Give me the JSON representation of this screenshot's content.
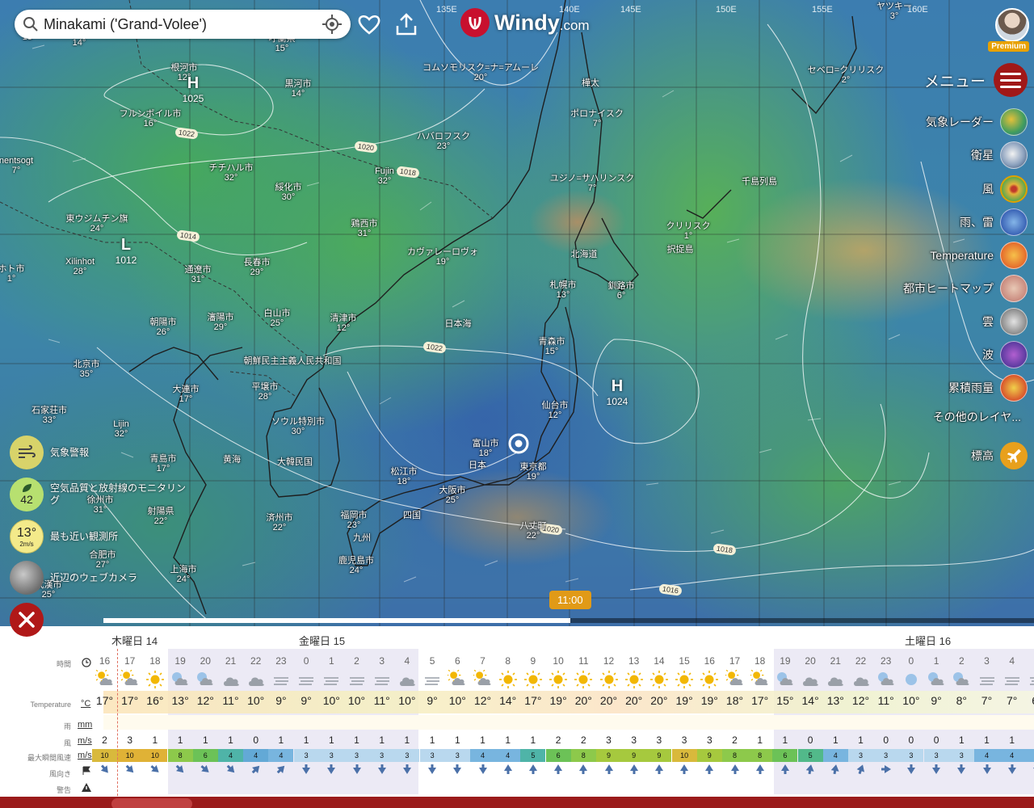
{
  "search": {
    "value": "Minakami ('Grand-Volee')"
  },
  "brand": {
    "name": "Windy",
    "suffix": ".com"
  },
  "account": {
    "badge": "Premium"
  },
  "menu": {
    "label": "メニュー"
  },
  "layers": [
    {
      "label": "気象レーダー",
      "icon": "radar-layer-icon"
    },
    {
      "label": "衛星",
      "icon": "satellite-layer-icon"
    },
    {
      "label": "風",
      "icon": "wind-layer-icon"
    },
    {
      "label": "雨、雷",
      "icon": "rain-layer-icon"
    },
    {
      "label": "Temperature",
      "icon": "temperature-layer-icon"
    },
    {
      "label": "都市ヒートマップ",
      "icon": "heatmap-layer-icon"
    },
    {
      "label": "雲",
      "icon": "clouds-layer-icon"
    },
    {
      "label": "波",
      "icon": "waves-layer-icon"
    },
    {
      "label": "累積雨量",
      "icon": "accumulated-rain-layer-icon"
    },
    {
      "label": "その他のレイヤ...",
      "icon": ""
    }
  ],
  "altitude": {
    "label": "標高"
  },
  "left_widgets": {
    "warnings": {
      "label": "気象警報"
    },
    "air_quality": {
      "value": "42",
      "label": "空気品質と放射線のモニタリング"
    },
    "station": {
      "temp": "13°",
      "wind": "2m/s",
      "label": "最も近い観測所"
    },
    "webcams": {
      "label": "近辺のウェブカメラ"
    }
  },
  "timeline": {
    "current_time": "11:00"
  },
  "longitudes": [
    "135E",
    "140E",
    "145E",
    "150E",
    "155E",
    "160E"
  ],
  "map_labels": [
    {
      "name": "",
      "temp": "13°"
    },
    {
      "name": "",
      "temp": "14°"
    },
    {
      "name": "呼蘭県",
      "temp": "15°"
    },
    {
      "name": "根河市",
      "temp": "12°"
    },
    {
      "name": "黒河市",
      "temp": "14°"
    },
    {
      "name": "フルンボイル市",
      "temp": "16°"
    },
    {
      "name": "チチハル市",
      "temp": "32°"
    },
    {
      "name": "ハバロフスク",
      "temp": "23°"
    },
    {
      "name": "コムソモリスク=ナ=アムーレ",
      "temp": "20°"
    },
    {
      "name": "Fujin",
      "temp": "32°"
    },
    {
      "name": "綏化市",
      "temp": "30°"
    },
    {
      "name": "樺太",
      "temp": ""
    },
    {
      "name": "ポロナイスク",
      "temp": "7°"
    },
    {
      "name": "ユジノ=サハリンスク",
      "temp": "7°"
    },
    {
      "name": "セベロ=クリリスク",
      "temp": "2°"
    },
    {
      "name": "ヤツキー",
      "temp": "3°"
    },
    {
      "name": "千島列島",
      "temp": ""
    },
    {
      "name": "東ウジムチン旗",
      "temp": "24°"
    },
    {
      "name": "鶏西市",
      "temp": "31°"
    },
    {
      "name": "クリリスク",
      "temp": "1°"
    },
    {
      "name": "択捉島",
      "temp": ""
    },
    {
      "name": "Xilinhot",
      "temp": "28°"
    },
    {
      "name": "長春市",
      "temp": "29°"
    },
    {
      "name": "カヴァレーロヴォ",
      "temp": "19°"
    },
    {
      "name": "通遼市",
      "temp": "31°"
    },
    {
      "name": "北海道",
      "temp": ""
    },
    {
      "name": "札幌市",
      "temp": "13°"
    },
    {
      "name": "釧路市",
      "temp": "6°"
    },
    {
      "name": "白山市",
      "temp": "25°"
    },
    {
      "name": "清津市",
      "temp": "12°"
    },
    {
      "name": "瀋陽市",
      "temp": "29°"
    },
    {
      "name": "朝陽市",
      "temp": "26°"
    },
    {
      "name": "日本海",
      "temp": ""
    },
    {
      "name": "青森市",
      "temp": "15°"
    },
    {
      "name": "北京市",
      "temp": "35°"
    },
    {
      "name": "朝鮮民主主義人民共和国",
      "temp": ""
    },
    {
      "name": "大連市",
      "temp": "17°"
    },
    {
      "name": "平壌市",
      "temp": "28°"
    },
    {
      "name": "仙台市",
      "temp": "12°"
    },
    {
      "name": "石家荘市",
      "temp": "33°"
    },
    {
      "name": "ソウル特別市",
      "temp": "30°"
    },
    {
      "name": "Lijin",
      "temp": "32°"
    },
    {
      "name": "富山市",
      "temp": "18°"
    },
    {
      "name": "日本",
      "temp": ""
    },
    {
      "name": "東京都",
      "temp": "19°"
    },
    {
      "name": "大韓民国",
      "temp": ""
    },
    {
      "name": "青島市",
      "temp": "17°"
    },
    {
      "name": "黄海",
      "temp": ""
    },
    {
      "name": "松江市",
      "temp": "18°"
    },
    {
      "name": "大阪市",
      "temp": "25°"
    },
    {
      "name": "徐州市",
      "temp": "31°"
    },
    {
      "name": "射陽県",
      "temp": "22°"
    },
    {
      "name": "済州市",
      "temp": "22°"
    },
    {
      "name": "福岡市",
      "temp": "23°"
    },
    {
      "name": "四国",
      "temp": ""
    },
    {
      "name": "九州",
      "temp": ""
    },
    {
      "name": "八丈町",
      "temp": "22°"
    },
    {
      "name": "合肥市",
      "temp": "27°"
    },
    {
      "name": "鹿児島市",
      "temp": "24°"
    },
    {
      "name": "上海市",
      "temp": "24°"
    },
    {
      "name": "武漢市",
      "temp": "25°"
    },
    {
      "name": "ホト市",
      "temp": "1°"
    },
    {
      "name": "nentsogt",
      "temp": "7°"
    }
  ],
  "pressure_systems": [
    {
      "type": "H",
      "value": "1025"
    },
    {
      "type": "L",
      "value": "1012"
    },
    {
      "type": "H",
      "value": "1024"
    }
  ],
  "isobars": [
    "1022",
    "1020",
    "1018",
    "1014",
    "1022",
    "1020",
    "1018",
    "1016"
  ],
  "forecast": {
    "days": [
      "木曜日 14",
      "金曜日 15",
      "土曜日 16"
    ],
    "row_labels": {
      "time": "時間",
      "temperature": "Temperature",
      "rain": "雨",
      "wind": "風",
      "gust": "最大瞬間風速",
      "direction": "風向き",
      "warning": "警告"
    },
    "units": {
      "temperature": "°C",
      "rain": "mm",
      "wind": "m/s",
      "gust": "m/s"
    },
    "hours": [
      "16",
      "17",
      "18",
      "19",
      "20",
      "21",
      "22",
      "23",
      "0",
      "1",
      "2",
      "3",
      "4",
      "5",
      "6",
      "7",
      "8",
      "9",
      "10",
      "11",
      "12",
      "13",
      "14",
      "15",
      "16",
      "17",
      "18",
      "19",
      "20",
      "21",
      "22",
      "23",
      "0",
      "1",
      "2",
      "3",
      "4",
      "5"
    ],
    "weather": [
      "sun-cloud",
      "sun-cloud",
      "sun",
      "moon-cloud",
      "moon-cloud",
      "cloud",
      "cloud",
      "fog",
      "fog",
      "fog",
      "fog",
      "fog",
      "cloud",
      "fog",
      "sun-cloud",
      "sun-cloud",
      "sun",
      "sun",
      "sun",
      "sun",
      "sun",
      "sun",
      "sun",
      "sun",
      "sun",
      "sun-cloud",
      "sun-cloud",
      "moon-cloud",
      "cloud",
      "cloud",
      "cloud",
      "moon-cloud",
      "moon",
      "moon-cloud",
      "moon-cloud",
      "fog",
      "fog",
      "fog"
    ],
    "temperatures": [
      "17°",
      "17°",
      "16°",
      "13°",
      "12°",
      "11°",
      "10°",
      "9°",
      "9°",
      "10°",
      "10°",
      "11°",
      "10°",
      "9°",
      "10°",
      "12°",
      "14°",
      "17°",
      "19°",
      "20°",
      "20°",
      "20°",
      "20°",
      "19°",
      "19°",
      "18°",
      "17°",
      "15°",
      "14°",
      "13°",
      "12°",
      "11°",
      "10°",
      "9°",
      "8°",
      "7°",
      "7°",
      "6°"
    ],
    "wind": [
      "2",
      "3",
      "1",
      "1",
      "1",
      "1",
      "0",
      "1",
      "1",
      "1",
      "1",
      "1",
      "1",
      "1",
      "1",
      "1",
      "1",
      "1",
      "2",
      "2",
      "3",
      "3",
      "3",
      "3",
      "3",
      "2",
      "1",
      "1",
      "0",
      "1",
      "1",
      "0",
      "0",
      "0",
      "1",
      "1",
      "1",
      "1"
    ],
    "gust": [
      "10",
      "10",
      "10",
      "8",
      "6",
      "4",
      "4",
      "4",
      "3",
      "3",
      "3",
      "3",
      "3",
      "3",
      "3",
      "4",
      "4",
      "5",
      "6",
      "8",
      "9",
      "9",
      "9",
      "10",
      "9",
      "8",
      "8",
      "6",
      "5",
      "4",
      "3",
      "3",
      "3",
      "3",
      "3",
      "4",
      "4",
      "4"
    ],
    "gust_colors": [
      "#d9b93c",
      "#e0b236",
      "#e0b236",
      "#8dc94b",
      "#6cc257",
      "#4fb4a8",
      "#63a9d6",
      "#78b5df",
      "#b9d8ee",
      "#b9d8ee",
      "#b9d8ee",
      "#b9d8ee",
      "#b9d8ee",
      "#b9d8ee",
      "#b9d8ee",
      "#78b5df",
      "#78b5df",
      "#4fb4a8",
      "#6cc257",
      "#8dc94b",
      "#a6c93e",
      "#a6c93e",
      "#a6c93e",
      "#d9b93c",
      "#a6c93e",
      "#8dc94b",
      "#8dc94b",
      "#6cc257",
      "#52b98a",
      "#78b5df",
      "#b9d8ee",
      "#b9d8ee",
      "#b9d8ee",
      "#b9d8ee",
      "#b9d8ee",
      "#78b5df",
      "#78b5df",
      "#78b5df"
    ],
    "direction_deg": [
      140,
      135,
      130,
      135,
      130,
      135,
      45,
      45,
      180,
      180,
      180,
      180,
      180,
      180,
      180,
      180,
      0,
      0,
      0,
      0,
      0,
      0,
      0,
      0,
      0,
      0,
      0,
      0,
      10,
      10,
      20,
      90,
      180,
      180,
      180,
      180,
      180,
      180
    ]
  }
}
